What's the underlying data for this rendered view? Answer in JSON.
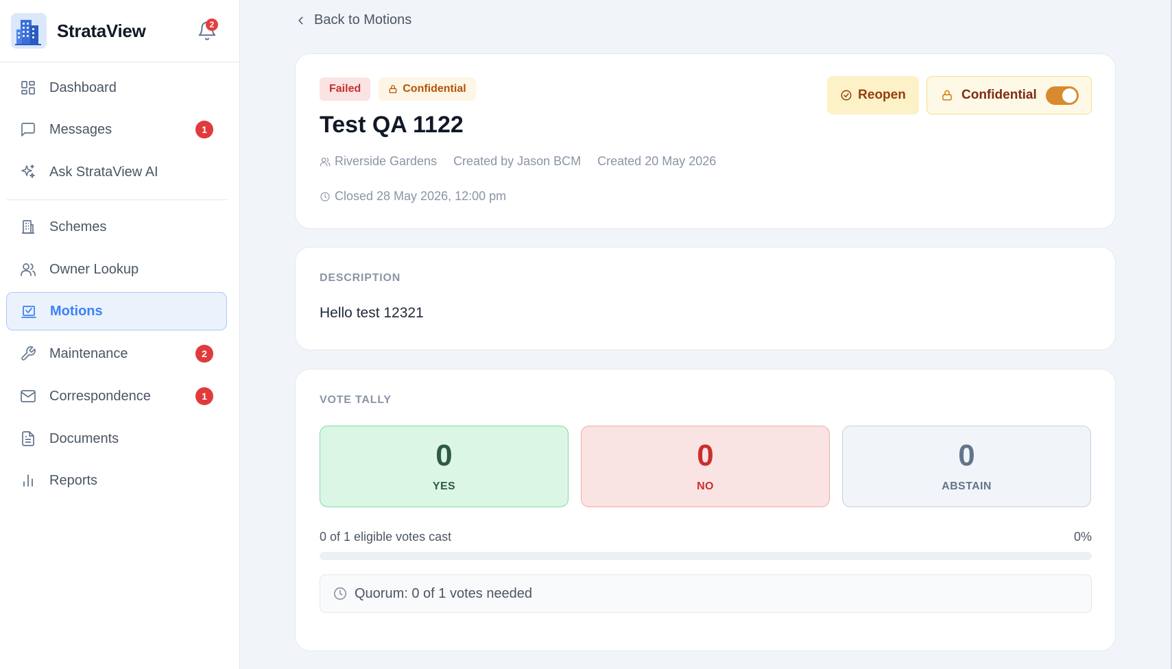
{
  "app": {
    "name": "StrataView",
    "notification_count": "2"
  },
  "sidebar": {
    "items": [
      {
        "label": "Dashboard",
        "icon": "dashboard-icon",
        "badge": ""
      },
      {
        "label": "Messages",
        "icon": "message-icon",
        "badge": "1"
      },
      {
        "label": "Ask StrataView AI",
        "icon": "sparkles-icon",
        "badge": ""
      },
      {
        "label": "Schemes",
        "icon": "building-icon",
        "badge": ""
      },
      {
        "label": "Owner Lookup",
        "icon": "users-icon",
        "badge": ""
      },
      {
        "label": "Motions",
        "icon": "vote-icon",
        "badge": "",
        "active": true
      },
      {
        "label": "Maintenance",
        "icon": "wrench-icon",
        "badge": "2"
      },
      {
        "label": "Correspondence",
        "icon": "mail-icon",
        "badge": "1"
      },
      {
        "label": "Documents",
        "icon": "document-icon",
        "badge": ""
      },
      {
        "label": "Reports",
        "icon": "bar-chart-icon",
        "badge": ""
      }
    ]
  },
  "main": {
    "back_label": "Back to Motions",
    "motion": {
      "status": "Failed",
      "confidential_badge": "Confidential",
      "title": "Test QA 1122",
      "scheme": "Riverside Gardens",
      "created_by": "Created by Jason BCM",
      "created_date": "Created 20 May 2026",
      "closed": "Closed 28 May 2026, 12:00 pm"
    },
    "actions": {
      "reopen_label": "Reopen",
      "confidential_label": "Confidential",
      "confidential_on": true
    },
    "description": {
      "label": "DESCRIPTION",
      "text": "Hello test 12321"
    },
    "tally": {
      "label": "VOTE TALLY",
      "yes": {
        "count": "0",
        "label": "YES"
      },
      "no": {
        "count": "0",
        "label": "NO"
      },
      "abstain": {
        "count": "0",
        "label": "ABSTAIN"
      },
      "votes_cast": "0 of 1 eligible votes cast",
      "percent": "0%",
      "progress_fraction": 0,
      "quorum": "Quorum: 0 of 1 votes needed"
    }
  },
  "colors": {
    "accent": "#3b82f6",
    "failed": "#c53030",
    "confidential": "#b45309",
    "toggle_on": "#d88a2f"
  }
}
